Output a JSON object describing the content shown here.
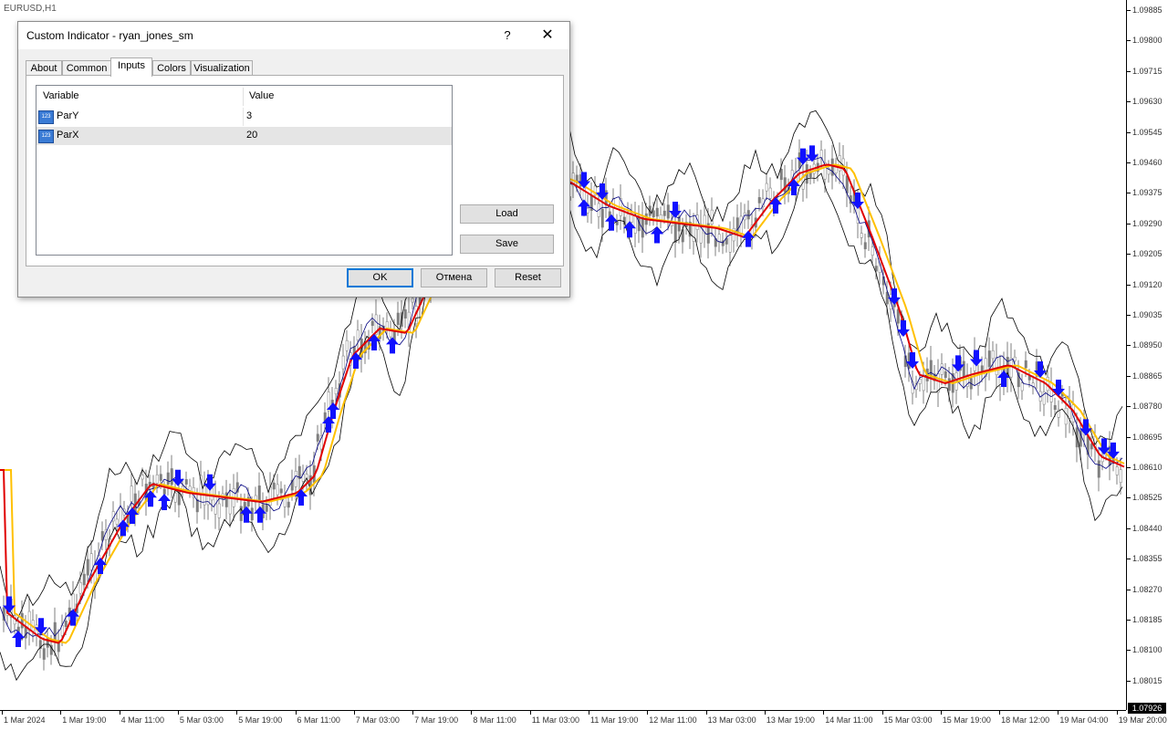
{
  "chart": {
    "symbol_label": "EURUSD,H1",
    "current_price": "1.07926",
    "price_labels": [
      "1.09885",
      "1.09800",
      "1.09715",
      "1.09630",
      "1.09545",
      "1.09460",
      "1.09375",
      "1.09290",
      "1.09205",
      "1.09120",
      "1.09035",
      "1.08950",
      "1.08865",
      "1.08780",
      "1.08695",
      "1.08610",
      "1.08525",
      "1.08440",
      "1.08355",
      "1.08270",
      "1.08185",
      "1.08100",
      "1.08015"
    ],
    "time_labels": [
      "1 Mar 2024",
      "1 Mar 19:00",
      "4 Mar 11:00",
      "5 Mar 03:00",
      "5 Mar 19:00",
      "6 Mar 11:00",
      "7 Mar 03:00",
      "7 Mar 19:00",
      "8 Mar 11:00",
      "11 Mar 03:00",
      "11 Mar 19:00",
      "12 Mar 11:00",
      "13 Mar 03:00",
      "13 Mar 19:00",
      "14 Mar 11:00",
      "15 Mar 03:00",
      "15 Mar 19:00",
      "18 Mar 12:00",
      "19 Mar 04:00",
      "19 Mar 20:00"
    ],
    "colors": {
      "fast_ma": "#e00000",
      "slow_ma": "#ffc000",
      "arrows": "#1010ff",
      "candles": "#7f7f7f",
      "envelope": "#000000",
      "blue_line": "#000080"
    }
  },
  "dialog": {
    "title": "Custom Indicator - ryan_jones_sm",
    "help_glyph": "?",
    "close_glyph": "✕",
    "tabs": [
      {
        "label": "About"
      },
      {
        "label": "Common"
      },
      {
        "label": "Inputs",
        "active": true
      },
      {
        "label": "Colors"
      },
      {
        "label": "Visualization"
      }
    ],
    "table": {
      "headers": {
        "variable": "Variable",
        "value": "Value"
      },
      "rows": [
        {
          "icon": "123",
          "variable": "ParY",
          "value": "3"
        },
        {
          "icon": "123",
          "variable": "ParX",
          "value": "20"
        }
      ]
    },
    "buttons": {
      "load": "Load",
      "save": "Save",
      "ok": "OK",
      "cancel": "Отмена",
      "reset": "Reset"
    }
  }
}
